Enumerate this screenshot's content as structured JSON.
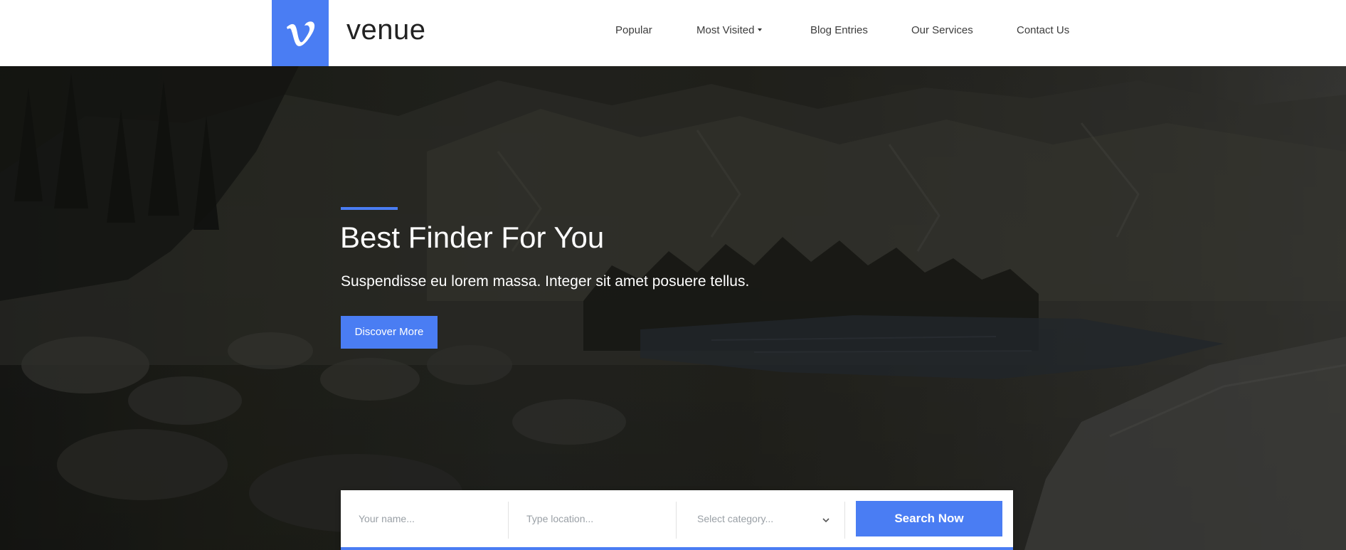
{
  "header": {
    "brand": "venue",
    "logo_icon": "vimeo-v-logo-icon",
    "nav": [
      {
        "label": "Popular",
        "has_dropdown": false
      },
      {
        "label": "Most Visited",
        "has_dropdown": true
      },
      {
        "label": "Blog Entries",
        "has_dropdown": false
      },
      {
        "label": "Our Services",
        "has_dropdown": false
      },
      {
        "label": "Contact Us",
        "has_dropdown": false
      }
    ]
  },
  "hero": {
    "title": "Best Finder For You",
    "subtitle": "Suspendisse eu lorem massa. Integer sit amet posuere tellus.",
    "button_label": "Discover More",
    "background": "mountain-lake-landscape-image"
  },
  "search": {
    "name_placeholder": "Your name...",
    "location_placeholder": "Type location...",
    "category_placeholder": "Select category...",
    "button_label": "Search Now"
  },
  "colors": {
    "accent": "#4a7df3",
    "header_bg": "#ffffff",
    "nav_text": "#3c3c3c",
    "placeholder_text": "#9aa0a6"
  }
}
